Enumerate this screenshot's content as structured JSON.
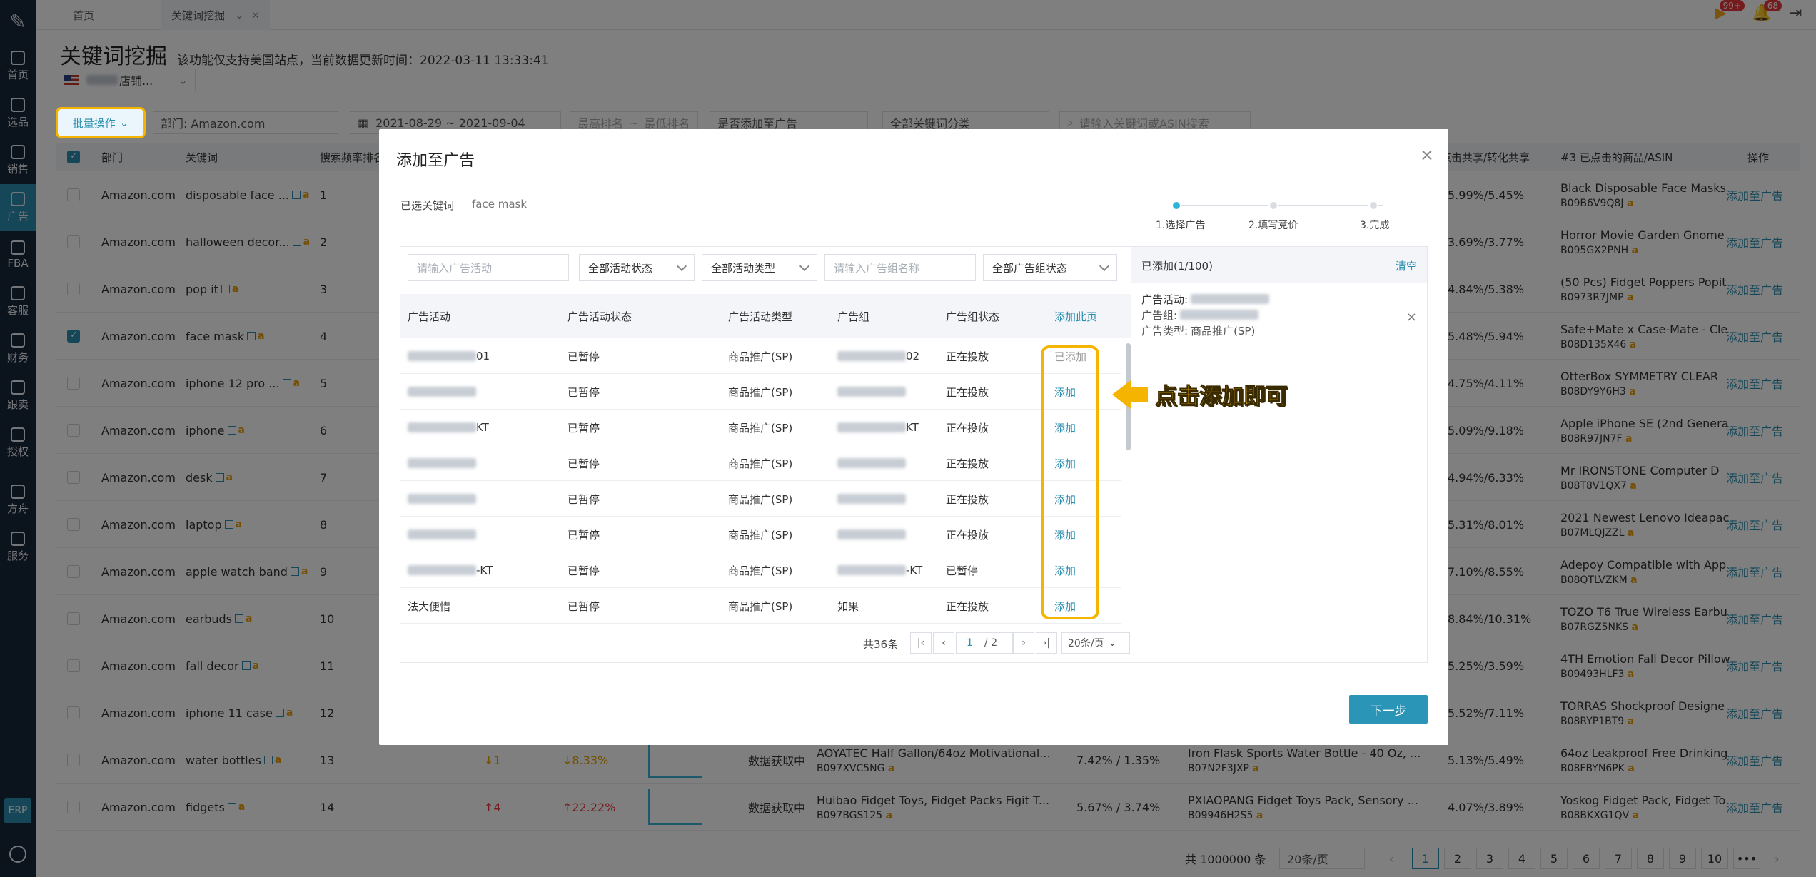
{
  "sidebar": {
    "items": [
      {
        "label": "首页",
        "icon": "home-icon"
      },
      {
        "label": "选品",
        "icon": "search-icon"
      },
      {
        "label": "销售",
        "icon": "chart-icon"
      },
      {
        "label": "广告",
        "icon": "ad-icon"
      },
      {
        "label": "FBA",
        "icon": "warehouse-icon"
      },
      {
        "label": "客服",
        "icon": "service-icon"
      },
      {
        "label": "财务",
        "icon": "finance-icon"
      },
      {
        "label": "跟卖",
        "icon": "pie-icon"
      },
      {
        "label": "授权",
        "icon": "shield-icon"
      },
      {
        "label": "方舟",
        "icon": "ark-icon"
      },
      {
        "label": "服务",
        "icon": "service-box-icon"
      }
    ],
    "erp": "ERP"
  },
  "topbar": {
    "tabs": [
      "首页",
      "关键词挖掘"
    ],
    "badges": {
      "msg": "99+",
      "notify": "68"
    }
  },
  "page": {
    "title": "关键词挖掘",
    "subtitle": "该功能仅支持美国站点，当前数据更新时间：2022-03-11 13:33:41",
    "store_label": "店铺...",
    "batch_label": "批量操作",
    "dept_label": "部门: Amazon.com",
    "date_range": "2021-08-29  ~  2021-09-04",
    "rank_from": "最高排名",
    "rank_sep": "~",
    "rank_to": "最低排名",
    "add_filter": "是否添加至广告",
    "category_filter": "全部关键词分类",
    "search_placeholder": "请输入关键词或ASIN搜索"
  },
  "table": {
    "headers": {
      "dept": "部门",
      "keyword": "关键词",
      "rank": "搜索频率排名",
      "share": "点击共享/转化共享",
      "third": "#3 已点击的商品/ASIN",
      "op": "操作"
    },
    "rows": [
      {
        "dept": "Amazon.com",
        "kw": "disposable face ...",
        "rank": "1",
        "share": "5.99%/5.45%",
        "p_name": "Black Disposable Face Masks",
        "p_asin": "B09B6V9Q8J",
        "checked": false
      },
      {
        "dept": "Amazon.com",
        "kw": "halloween decor...",
        "rank": "2",
        "share": "3.69%/3.77%",
        "p_name": "Horror Movie Garden Gnome",
        "p_asin": "B095GX2PNH",
        "checked": false
      },
      {
        "dept": "Amazon.com",
        "kw": "pop it",
        "rank": "3",
        "share": "4.84%/5.38%",
        "p_name": "(50 Pcs) Fidget Poppers Popit",
        "p_asin": "B0973R7JMP",
        "checked": false
      },
      {
        "dept": "Amazon.com",
        "kw": "face mask",
        "rank": "4",
        "share": "5.48%/5.94%",
        "p_name": "Safe+Mate x Case-Mate - Cle",
        "p_asin": "B08D135X46",
        "checked": true
      },
      {
        "dept": "Amazon.com",
        "kw": "iphone 12 pro ...",
        "rank": "5",
        "share": "4.75%/4.11%",
        "p_name": "OtterBox SYMMETRY CLEAR",
        "p_asin": "B08DY9Y6H3",
        "checked": false
      },
      {
        "dept": "Amazon.com",
        "kw": "iphone",
        "rank": "6",
        "share": "5.09%/9.18%",
        "p_name": "Apple iPhone SE (2nd Genera",
        "p_asin": "B08R97JN7F",
        "checked": false
      },
      {
        "dept": "Amazon.com",
        "kw": "desk",
        "rank": "7",
        "share": "4.94%/6.33%",
        "p_name": "Mr IRONSTONE Computer D",
        "p_asin": "B08T8V1QX7",
        "checked": false
      },
      {
        "dept": "Amazon.com",
        "kw": "laptop",
        "rank": "8",
        "share": "5.31%/8.01%",
        "p_name": "2021 Newest Lenovo Ideapac",
        "p_asin": "B07MLQJZZL",
        "checked": false
      },
      {
        "dept": "Amazon.com",
        "kw": "apple watch band",
        "rank": "9",
        "share": "7.10%/8.55%",
        "p_name": "Adepoy Compatible with App",
        "p_asin": "B08QTLVZKM",
        "checked": false
      },
      {
        "dept": "Amazon.com",
        "kw": "earbuds",
        "rank": "10",
        "share": "8.84%/10.31%",
        "p_name": "TOZO T6 True Wireless Earbu",
        "p_asin": "B07RGZ5NKS",
        "checked": false
      },
      {
        "dept": "Amazon.com",
        "kw": "fall decor",
        "rank": "11",
        "share": "5.25%/3.59%",
        "p_name": "4TH Emotion Fall Decor Pillow",
        "p_asin": "B09493HLF3",
        "checked": false
      },
      {
        "dept": "Amazon.com",
        "kw": "iphone 11 case",
        "rank": "12",
        "share": "5.52%/7.11%",
        "p_name": "TORRAS Shockproof Designe",
        "p_asin": "B08RYP1BT9",
        "checked": false
      },
      {
        "dept": "Amazon.com",
        "kw": "water bottles",
        "rank": "13",
        "share": "5.13%/5.49%",
        "p_name": "64oz Leakproof Free Drinking",
        "p_asin": "B08FBYN6PK",
        "checked": false,
        "trend": "↓1",
        "pct": "↓8.33%",
        "status": "数据获取中",
        "c1_name": "AOYATEC Half Gallon/64oz Motivational...",
        "c1_asin": "B097XVC5NG",
        "c1_share": "7.42% / 1.35%",
        "c2_name": "Iron Flask Sports Water Bottle - 40 Oz, ...",
        "c2_asin": "B07N2F3JXP"
      },
      {
        "dept": "Amazon.com",
        "kw": "fidgets",
        "rank": "14",
        "share": "4.07%/3.89%",
        "p_name": "Yoskog Fidget Pack, Fidget To",
        "p_asin": "B08BKXG1QV",
        "checked": false,
        "trend": "↑4",
        "pct": "↑22.22%",
        "status": "数据获取中",
        "c1_name": "Huibao Fidget Toys, Fidget Packs Figit T...",
        "c1_asin": "B097BGS125",
        "c1_share": "5.67% / 3.74%",
        "c2_name": "PXIAOPANG Fidget Toys Pack, Sensory ...",
        "c2_asin": "B09946H2S5"
      }
    ],
    "op_label": "添加至广告"
  },
  "bottom_pager": {
    "total": "共 1000000 条",
    "size": "20条/页",
    "pages": [
      "1",
      "2",
      "3",
      "4",
      "5",
      "6",
      "7",
      "8",
      "9",
      "10",
      "•••"
    ]
  },
  "modal": {
    "title": "添加至广告",
    "selected_label": "已选关键词",
    "selected_value": "face mask",
    "steps": [
      "1.选择广告",
      "2.填写竞价",
      "3.完成"
    ],
    "filters": {
      "campaign_ph": "请输入广告活动",
      "campaign_status": "全部活动状态",
      "campaign_type": "全部活动类型",
      "group_ph": "请输入广告组名称",
      "group_status": "全部广告组状态"
    },
    "headers": {
      "campaign": "广告活动",
      "status": "广告活动状态",
      "type": "广告活动类型",
      "group": "广告组",
      "group_status": "广告组状态",
      "add_page": "添加此页"
    },
    "rows": [
      {
        "campaign_tail": "01",
        "status": "已暂停",
        "type": "商品推广(SP)",
        "group_tail": "02",
        "gstatus": "正在投放",
        "action": "已添加",
        "added": true
      },
      {
        "campaign_tail": "",
        "status": "已暂停",
        "type": "商品推广(SP)",
        "group_tail": "",
        "gstatus": "正在投放",
        "action": "添加",
        "added": false
      },
      {
        "campaign_tail": "KT",
        "status": "已暂停",
        "type": "商品推广(SP)",
        "group_tail": "KT",
        "gstatus": "正在投放",
        "action": "添加",
        "added": false
      },
      {
        "campaign_tail": "",
        "status": "已暂停",
        "type": "商品推广(SP)",
        "group_tail": "",
        "gstatus": "正在投放",
        "action": "添加",
        "added": false
      },
      {
        "campaign_tail": "",
        "status": "已暂停",
        "type": "商品推广(SP)",
        "group_tail": "",
        "gstatus": "正在投放",
        "action": "添加",
        "added": false
      },
      {
        "campaign_tail": "",
        "status": "已暂停",
        "type": "商品推广(SP)",
        "group_tail": "",
        "gstatus": "正在投放",
        "action": "添加",
        "added": false
      },
      {
        "campaign_tail": "-KT",
        "status": "已暂停",
        "type": "商品推广(SP)",
        "group_tail": "-KT",
        "gstatus": "已暂停",
        "action": "添加",
        "added": false
      },
      {
        "campaign_full": "法大便惜",
        "status": "已暂停",
        "type": "商品推广(SP)",
        "group_full": "如果",
        "gstatus": "正在投放",
        "action": "添加",
        "added": false
      }
    ],
    "pager": {
      "total": "共36条",
      "current": "1",
      "of": "/ 2",
      "size": "20条/页"
    },
    "right": {
      "title": "已添加(1/100)",
      "clear": "清空",
      "campaign_k": "广告活动:",
      "group_k": "广告组:",
      "type_k": "广告类型:",
      "type_v": "商品推广(SP)"
    },
    "next": "下一步"
  },
  "callout": {
    "text": "点击添加即可"
  },
  "colors": {
    "accent": "#2b8fb0",
    "highlight": "#f5b400",
    "sidebar": "#17263a"
  }
}
